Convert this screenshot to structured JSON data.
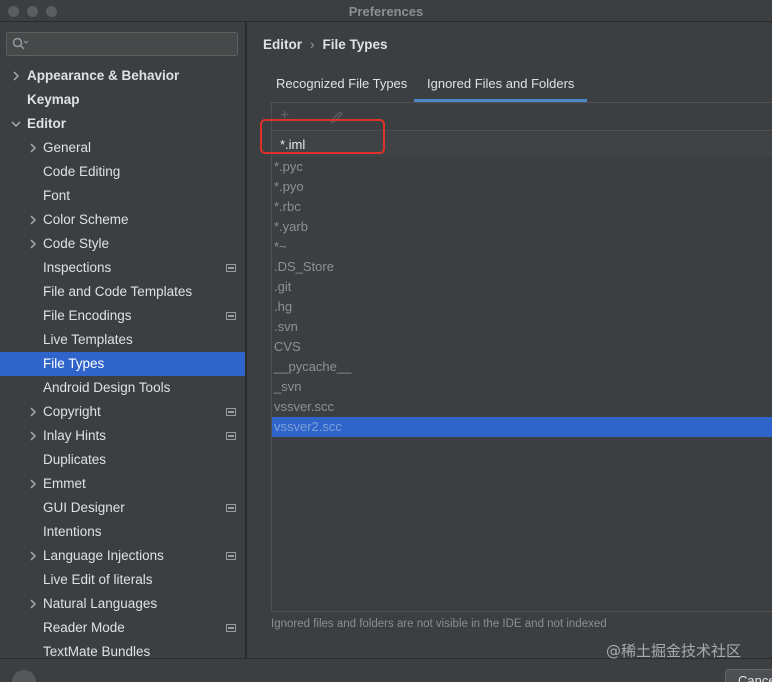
{
  "window": {
    "title": "Preferences"
  },
  "search": {
    "placeholder": ""
  },
  "sidebar": {
    "items": [
      {
        "label": "Appearance & Behavior"
      },
      {
        "label": "Keymap"
      },
      {
        "label": "Editor"
      },
      {
        "label": "General"
      },
      {
        "label": "Code Editing"
      },
      {
        "label": "Font"
      },
      {
        "label": "Color Scheme"
      },
      {
        "label": "Code Style"
      },
      {
        "label": "Inspections"
      },
      {
        "label": "File and Code Templates"
      },
      {
        "label": "File Encodings"
      },
      {
        "label": "Live Templates"
      },
      {
        "label": "File Types"
      },
      {
        "label": "Android Design Tools"
      },
      {
        "label": "Copyright"
      },
      {
        "label": "Inlay Hints"
      },
      {
        "label": "Duplicates"
      },
      {
        "label": "Emmet"
      },
      {
        "label": "GUI Designer"
      },
      {
        "label": "Intentions"
      },
      {
        "label": "Language Injections"
      },
      {
        "label": "Live Edit of literals"
      },
      {
        "label": "Natural Languages"
      },
      {
        "label": "Reader Mode"
      },
      {
        "label": "TextMate Bundles"
      }
    ],
    "selected": "File Types"
  },
  "breadcrumb": {
    "parent": "Editor",
    "current": "File Types"
  },
  "tabs": [
    {
      "label": "Recognized File Types"
    },
    {
      "label": "Ignored Files and Folders"
    }
  ],
  "toolbar": {
    "add_icon": "plus-icon",
    "edit_icon": "pencil-icon"
  },
  "ignored": {
    "items": [
      "*.iml",
      "*.pyc",
      "*.pyo",
      "*.rbc",
      "*.yarb",
      "*~",
      ".DS_Store",
      ".git",
      ".hg",
      ".svn",
      "CVS",
      "__pycache__",
      "_svn",
      "vssver.scc",
      "vssver2.scc"
    ],
    "selected": "vssver2.scc",
    "highlighted": "*.iml"
  },
  "hint": "Ignored files and folders are not visible in the IDE and not indexed",
  "buttons": {
    "cancel": "Cancel"
  },
  "watermark": "@稀土掘金技术社区",
  "colors": {
    "accent": "#2f65ca",
    "tab_underline": "#4a88c7",
    "annotation": "#e0302a"
  }
}
